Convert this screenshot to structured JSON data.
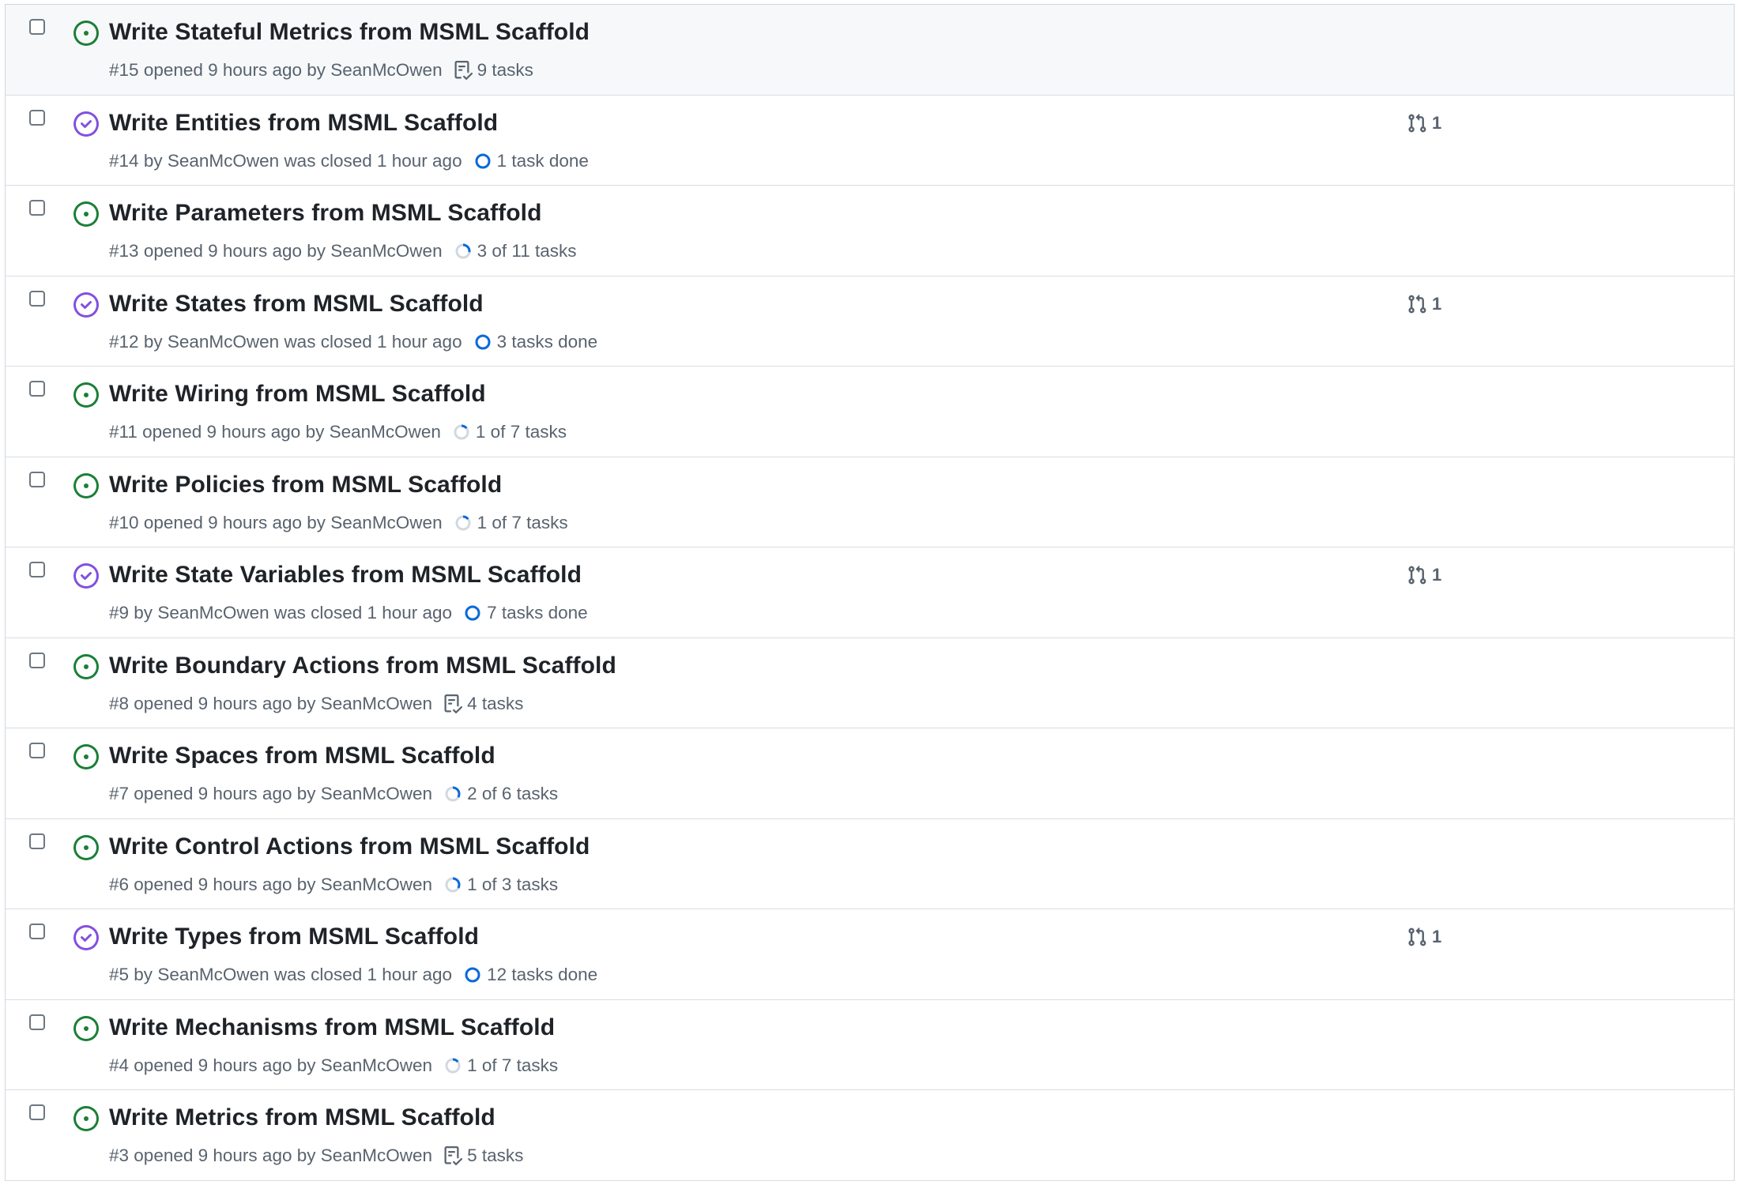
{
  "colors": {
    "open": "#1a7f37",
    "closed": "#8250df",
    "progress": "#0969da",
    "progress_track": "#d1d9e0",
    "muted": "#59636e"
  },
  "issues": [
    {
      "title": "Write Stateful Metrics from MSML Scaffold",
      "number": "#15",
      "state": "open",
      "meta_mid": "opened 9 hours ago by",
      "author": "SeanMcOwen",
      "meta_tail": "",
      "task_kind": "list",
      "task_text": "9 tasks",
      "task_progress": 0,
      "pr_count": ""
    },
    {
      "title": "Write Entities from MSML Scaffold",
      "number": "#14",
      "state": "closed",
      "meta_mid": "by",
      "author": "SeanMcOwen",
      "meta_tail": "was closed 1 hour ago",
      "task_kind": "done",
      "task_text": "1 task done",
      "task_progress": 1,
      "pr_count": "1"
    },
    {
      "title": "Write Parameters from MSML Scaffold",
      "number": "#13",
      "state": "open",
      "meta_mid": "opened 9 hours ago by",
      "author": "SeanMcOwen",
      "meta_tail": "",
      "task_kind": "progress",
      "task_text": "3 of 11 tasks",
      "task_progress": 0.2727,
      "pr_count": ""
    },
    {
      "title": "Write States from MSML Scaffold",
      "number": "#12",
      "state": "closed",
      "meta_mid": "by",
      "author": "SeanMcOwen",
      "meta_tail": "was closed 1 hour ago",
      "task_kind": "done",
      "task_text": "3 tasks done",
      "task_progress": 1,
      "pr_count": "1"
    },
    {
      "title": "Write Wiring from MSML Scaffold",
      "number": "#11",
      "state": "open",
      "meta_mid": "opened 9 hours ago by",
      "author": "SeanMcOwen",
      "meta_tail": "",
      "task_kind": "progress",
      "task_text": "1 of 7 tasks",
      "task_progress": 0.1429,
      "pr_count": ""
    },
    {
      "title": "Write Policies from MSML Scaffold",
      "number": "#10",
      "state": "open",
      "meta_mid": "opened 9 hours ago by",
      "author": "SeanMcOwen",
      "meta_tail": "",
      "task_kind": "progress",
      "task_text": "1 of 7 tasks",
      "task_progress": 0.1429,
      "pr_count": ""
    },
    {
      "title": "Write State Variables from MSML Scaffold",
      "number": "#9",
      "state": "closed",
      "meta_mid": "by",
      "author": "SeanMcOwen",
      "meta_tail": "was closed 1 hour ago",
      "task_kind": "done",
      "task_text": "7 tasks done",
      "task_progress": 1,
      "pr_count": "1"
    },
    {
      "title": "Write Boundary Actions from MSML Scaffold",
      "number": "#8",
      "state": "open",
      "meta_mid": "opened 9 hours ago by",
      "author": "SeanMcOwen",
      "meta_tail": "",
      "task_kind": "list",
      "task_text": "4 tasks",
      "task_progress": 0,
      "pr_count": ""
    },
    {
      "title": "Write Spaces from MSML Scaffold",
      "number": "#7",
      "state": "open",
      "meta_mid": "opened 9 hours ago by",
      "author": "SeanMcOwen",
      "meta_tail": "",
      "task_kind": "progress",
      "task_text": "2 of 6 tasks",
      "task_progress": 0.3333,
      "pr_count": ""
    },
    {
      "title": "Write Control Actions from MSML Scaffold",
      "number": "#6",
      "state": "open",
      "meta_mid": "opened 9 hours ago by",
      "author": "SeanMcOwen",
      "meta_tail": "",
      "task_kind": "progress",
      "task_text": "1 of 3 tasks",
      "task_progress": 0.3333,
      "pr_count": ""
    },
    {
      "title": "Write Types from MSML Scaffold",
      "number": "#5",
      "state": "closed",
      "meta_mid": "by",
      "author": "SeanMcOwen",
      "meta_tail": "was closed 1 hour ago",
      "task_kind": "done",
      "task_text": "12 tasks done",
      "task_progress": 1,
      "pr_count": "1"
    },
    {
      "title": "Write Mechanisms from MSML Scaffold",
      "number": "#4",
      "state": "open",
      "meta_mid": "opened 9 hours ago by",
      "author": "SeanMcOwen",
      "meta_tail": "",
      "task_kind": "progress",
      "task_text": "1 of 7 tasks",
      "task_progress": 0.1429,
      "pr_count": ""
    },
    {
      "title": "Write Metrics from MSML Scaffold",
      "number": "#3",
      "state": "open",
      "meta_mid": "opened 9 hours ago by",
      "author": "SeanMcOwen",
      "meta_tail": "",
      "task_kind": "list",
      "task_text": "5 tasks",
      "task_progress": 0,
      "pr_count": ""
    }
  ]
}
